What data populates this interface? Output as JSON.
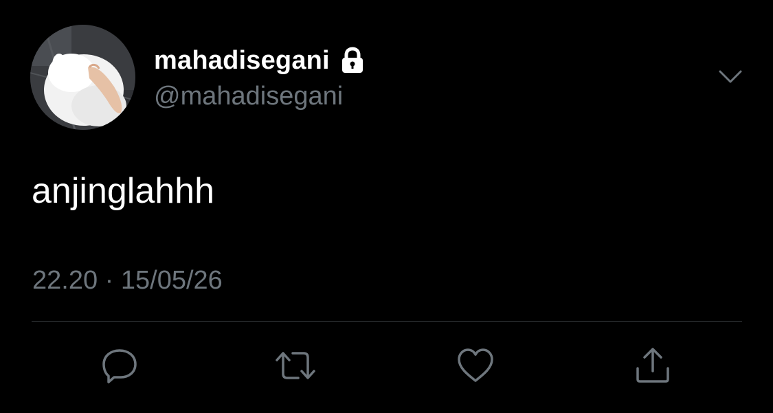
{
  "tweet": {
    "display_name": "mahadisegani",
    "handle": "@mahadisegani",
    "text": "anjinglahhh",
    "timestamp": "22.20 · 15/05/26",
    "protected_icon": "lock-icon",
    "menu_icon": "chevron-down-icon"
  },
  "actions": [
    {
      "name": "reply",
      "icon": "reply-icon"
    },
    {
      "name": "retweet",
      "icon": "retweet-icon"
    },
    {
      "name": "like",
      "icon": "heart-icon"
    },
    {
      "name": "share",
      "icon": "share-icon"
    }
  ],
  "colors": {
    "background": "#000000",
    "primary_text": "#ffffff",
    "secondary_text": "#6e767d",
    "divider": "#2f3336",
    "icon": "#6e767d"
  }
}
